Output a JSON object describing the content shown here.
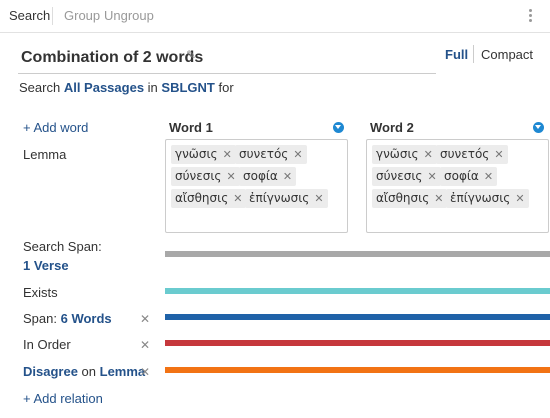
{
  "toolbar": {
    "tabs": [
      "Search",
      "Group",
      "Ungroup"
    ]
  },
  "header": {
    "title": "Combination of 2 words",
    "view_full": "Full",
    "view_compact": "Compact"
  },
  "search": {
    "prefix": "Search",
    "scope": "All Passages",
    "in": "in",
    "bible": "SBLGNT",
    "suffix": "for"
  },
  "add_word": "+ Add word",
  "lemma_label": "Lemma",
  "words": [
    {
      "title": "Word 1",
      "lemmas": [
        "γνῶσις",
        "συνετός",
        "σύνεσις",
        "σοφία",
        "αἴσθησις",
        "ἐπίγνωσις"
      ]
    },
    {
      "title": "Word 2",
      "lemmas": [
        "γνῶσις",
        "συνετός",
        "σύνεσις",
        "σοφία",
        "αἴσθησις",
        "ἐπίγνωσις"
      ]
    }
  ],
  "search_span": {
    "label": "Search Span:",
    "value": "1 Verse"
  },
  "relations": [
    {
      "name": "Exists",
      "color": "#6acbcf"
    },
    {
      "prefix": "Span:",
      "value": "6 Words",
      "color": "#1f62a8"
    },
    {
      "name": "In Order",
      "color": "#c6383c"
    },
    {
      "value": "Disagree",
      "mid": "on",
      "value2": "Lemma",
      "color": "#f27314"
    }
  ],
  "span_bar_color": "#a8a8a8",
  "add_relation": "+ Add relation"
}
